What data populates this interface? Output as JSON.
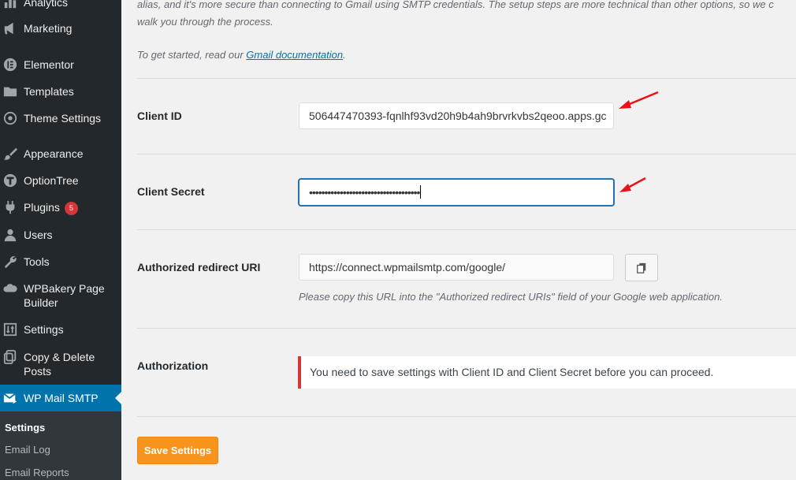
{
  "sidebar": {
    "items": [
      {
        "label": "Analytics",
        "icon": "bar-chart-icon"
      },
      {
        "label": "Marketing",
        "icon": "megaphone-icon"
      },
      {
        "label": "Elementor",
        "icon": "elementor-icon"
      },
      {
        "label": "Templates",
        "icon": "folder-icon"
      },
      {
        "label": "Theme Settings",
        "icon": "theme-settings-icon"
      },
      {
        "label": "Appearance",
        "icon": "paintbrush-icon"
      },
      {
        "label": "OptionTree",
        "icon": "optiontree-icon"
      },
      {
        "label": "Plugins",
        "icon": "plugin-icon",
        "badge": "5"
      },
      {
        "label": "Users",
        "icon": "user-icon"
      },
      {
        "label": "Tools",
        "icon": "wrench-icon"
      },
      {
        "label": "WPBakery Page Builder",
        "icon": "wpbakery-icon"
      },
      {
        "label": "Settings",
        "icon": "settings-sliders-icon"
      },
      {
        "label": "Copy & Delete Posts",
        "icon": "copy-posts-icon"
      },
      {
        "label": "WP Mail SMTP",
        "icon": "mail-icon"
      }
    ],
    "submenu": [
      {
        "label": "Settings"
      },
      {
        "label": "Email Log"
      },
      {
        "label": "Email Reports"
      }
    ]
  },
  "main": {
    "intro_line1": "alias, and it's more secure than connecting to Gmail using SMTP credentials. The setup steps are more technical than other options, so we c",
    "intro_line2": "walk you through the process.",
    "get_started_prefix": "To get started, read our ",
    "gmail_doc_link": "Gmail documentation",
    "get_started_suffix": ".",
    "client_id": {
      "label": "Client ID",
      "value": "506447470393-fqnlhf93vd20h9b4ah9brvrkvbs2qeoo.apps.gc"
    },
    "client_secret": {
      "label": "Client Secret",
      "value": "••••••••••••••••••••••••••••••••••••"
    },
    "redirect_uri": {
      "label": "Authorized redirect URI",
      "value": "https://connect.wpmailsmtp.com/google/",
      "help": "Please copy this URL into the \"Authorized redirect URIs\" field of your Google web application."
    },
    "authorization": {
      "label": "Authorization",
      "notice": "You need to save settings with Client ID and Client Secret before you can proceed."
    },
    "save_button": "Save Settings"
  },
  "colors": {
    "sidebar_bg": "#23282d",
    "active_bg": "#0073aa",
    "save_button": "#f7941d",
    "error_border": "#d63638",
    "annotation_arrow": "#e8121b"
  }
}
